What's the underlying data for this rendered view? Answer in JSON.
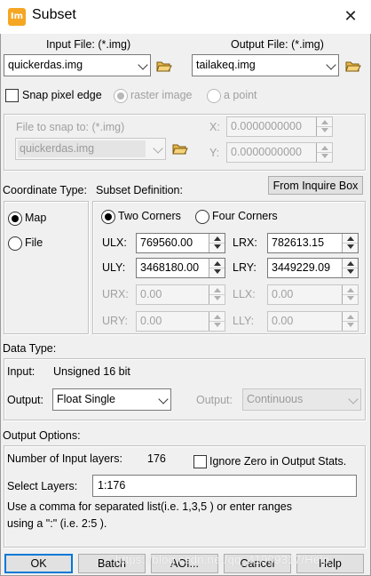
{
  "window": {
    "app_icon_text": "Im",
    "title": "Subset",
    "close_glyph": "✕"
  },
  "files": {
    "input_label": "Input File: (*.img)",
    "input_value": "quickerdas.img",
    "output_label": "Output File: (*.img)",
    "output_value": "tailakeq.img"
  },
  "snap": {
    "checkbox_label": "Snap pixel edge",
    "option_raster": "raster image",
    "option_point": "a point",
    "file_label": "File to snap to: (*.img)",
    "file_value": "quickerdas.img",
    "x_label": "X:",
    "x_value": "0.0000000000",
    "y_label": "Y:",
    "y_value": "0.0000000000"
  },
  "coordinate": {
    "type_label": "Coordinate Type:",
    "map_label": "Map",
    "file_label": "File"
  },
  "subset": {
    "definition_label": "Subset Definition:",
    "inquire_button": "From Inquire Box",
    "two_corners": "Two Corners",
    "four_corners": "Four Corners",
    "ulx_label": "ULX:",
    "ulx_value": "769560.00",
    "lrx_label": "LRX:",
    "lrx_value": "782613.15",
    "uly_label": "ULY:",
    "uly_value": "3468180.00",
    "lry_label": "LRY:",
    "lry_value": "3449229.09",
    "urx_label": "URX:",
    "urx_value": "0.00",
    "llx_label": "LLX:",
    "llx_value": "0.00",
    "ury_label": "URY:",
    "ury_value": "0.00",
    "lly_label": "LLY:",
    "lly_value": "0.00"
  },
  "data_type": {
    "section_label": "Data Type:",
    "input_label": "Input:",
    "input_value": "Unsigned 16 bit",
    "output_label": "Output:",
    "output_value": "Float Single",
    "output2_label": "Output:",
    "output2_value": "Continuous"
  },
  "output_options": {
    "section_label": "Output Options:",
    "num_layers_label": "Number of Input layers:",
    "num_layers_value": "176",
    "ignore_zero_label": "Ignore Zero in Output Stats.",
    "select_layers_label": "Select Layers:",
    "select_layers_value": "1:176",
    "hint_line1": "Use a comma for separated list(i.e. 1,3,5 ) or enter ranges",
    "hint_line2": "using a \":\" (i.e. 2:5 )."
  },
  "buttons": {
    "ok": "OK",
    "batch": "Batch",
    "aoi": "AOI...",
    "cancel": "Cancel",
    "help": "Help"
  },
  "watermark": "https://blog.csdn.net/qq_41909317/Help"
}
